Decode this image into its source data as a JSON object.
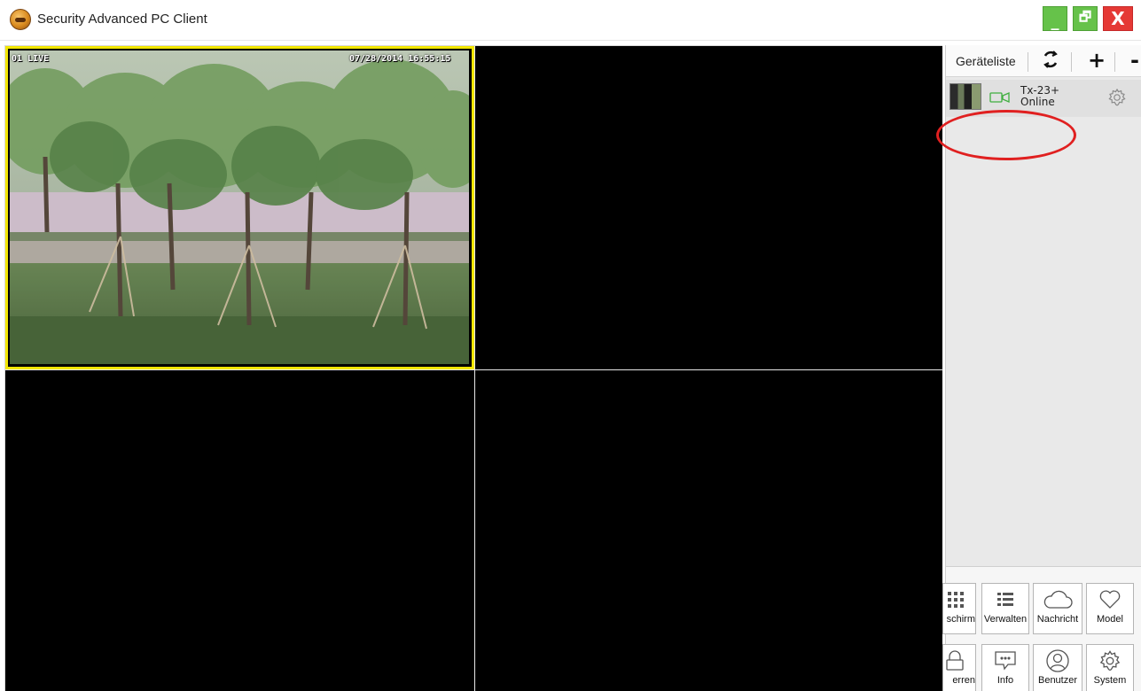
{
  "window": {
    "title": "Security Advanced PC Client",
    "minimize": "_",
    "maximize": "🗗",
    "close": "X"
  },
  "video": {
    "channel1": {
      "osd_left": "01 LIVE",
      "osd_right": "07/28/2014 16:55:15",
      "selected": true
    }
  },
  "sidebar": {
    "tab_label": "Geräteliste",
    "refresh_icon": "refresh-icon",
    "add_icon": "+",
    "remove_icon": "-",
    "device": {
      "name": "Tx-23+",
      "status": "Online"
    },
    "tiles": [
      {
        "label": "schirm",
        "icon": "grid-icon"
      },
      {
        "label": "Verwalten",
        "icon": "list-icon"
      },
      {
        "label": "Nachricht",
        "icon": "cloud-icon"
      },
      {
        "label": "Model",
        "icon": "heart-icon"
      },
      {
        "label": "erren",
        "icon": "lock-icon"
      },
      {
        "label": "Info",
        "icon": "chat-icon"
      },
      {
        "label": "Benutzer",
        "icon": "user-icon"
      },
      {
        "label": "System",
        "icon": "gear-icon"
      }
    ]
  },
  "colors": {
    "selection": "#f2e600",
    "annotation": "#e02020",
    "window_btn_green": "#66c24a",
    "window_btn_red": "#e53935"
  }
}
